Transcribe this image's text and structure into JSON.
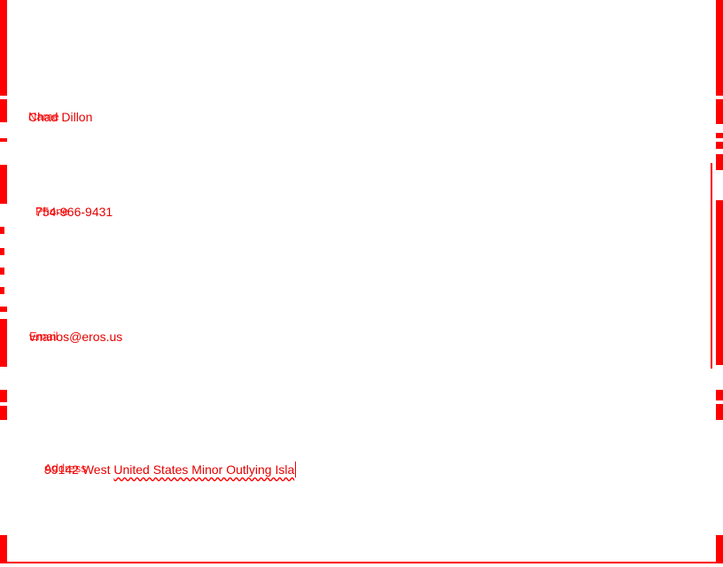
{
  "form": {
    "name_label": "Name",
    "name_value": "Chad Dillon",
    "phone_label": "Phone",
    "phone_value": "754-966-9431",
    "email_label": "Email",
    "email_value": "vnanos@eros.us",
    "address_label": "Address",
    "address_value_prefix": "99142 West ",
    "address_value_spelled": "United States Minor Outlying Isla"
  },
  "colors": {
    "accent": "#ff0000",
    "text": "#e60000",
    "background": "#ffffff"
  }
}
